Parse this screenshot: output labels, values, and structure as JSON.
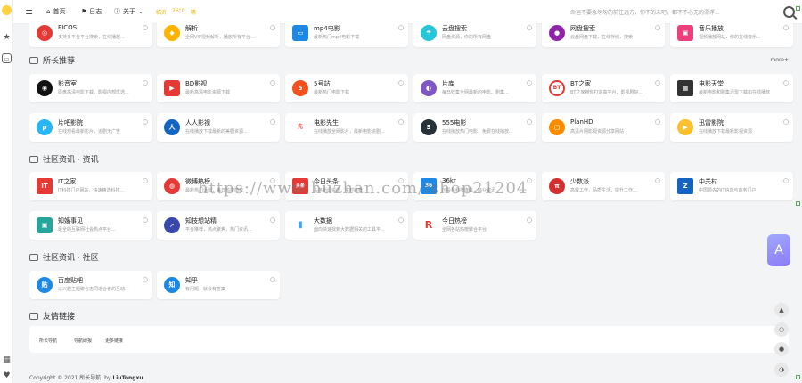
{
  "colors": {
    "accent": "#e5b200",
    "panel": "#ffffff",
    "bg": "#f3f4f6"
  },
  "topbar": {
    "menu_icon": "hamburger-icon",
    "nav": [
      {
        "label": "首页",
        "icon": "home-icon"
      },
      {
        "label": "日志",
        "icon": "flag-icon"
      },
      {
        "label": "关于",
        "icon": "info-icon"
      }
    ],
    "weather": {
      "city": "临沂",
      "temp": "26°C",
      "cond": "晴"
    },
    "slogan": "命运不要急匆匆的前往远方，你不的未吧，都不不心无的漂浮..."
  },
  "sections": [
    {
      "title": "所长推荐",
      "more": "more+"
    },
    {
      "title": "社区资讯 · 资讯"
    },
    {
      "title": "社区资讯 · 社区"
    },
    {
      "title": "友情链接"
    }
  ],
  "top_row": [
    {
      "name": "PICOS",
      "desc": "支持多平台平台搜索，在线播放..."
    },
    {
      "name": "解析",
      "desc": "全网VIP视频解析，播放所有平台..."
    },
    {
      "name": "mp4电影",
      "desc": "最新热门mp4电影下载"
    },
    {
      "name": "云盘搜索",
      "desc": "网盘资源，你的所有网盘"
    },
    {
      "name": "网盘搜索",
      "desc": "云盘网盘下载，在线存储，搜索"
    },
    {
      "name": "音乐播放",
      "desc": "视频播放网站，你的在线音乐..."
    }
  ],
  "recommend": [
    {
      "name": "影音室",
      "desc": "原盘高清电影下载，影视内部优选..."
    },
    {
      "name": "BD影视",
      "desc": "最新高清电影资源下载"
    },
    {
      "name": "5号站",
      "desc": "最新热门电影下载"
    },
    {
      "name": "片库",
      "desc": "每日收集全网最新的电影、剧集..."
    },
    {
      "name": "BT之家",
      "desc": "BT之家带你打造高平台，影视剧好..."
    },
    {
      "name": "电影天堂",
      "desc": "最新电影和剧集迅雷下载和在线播放"
    },
    {
      "name": "片吧影院",
      "desc": "在线观看最新影片，追剧无广告"
    },
    {
      "name": "人人影视",
      "desc": "在线播放下载最新的美剧资源..."
    },
    {
      "name": "电影先生",
      "desc": "在线播放全网影片，最新电影追剧..."
    },
    {
      "name": "555电影",
      "desc": "在线播放热门电影，免费在线播放..."
    },
    {
      "name": "PlanHD",
      "desc": "高清片网影视资源分享网站"
    },
    {
      "name": "迅雷影院",
      "desc": "在线播放下载最新影视资源"
    }
  ],
  "news": [
    {
      "name": "IT之家",
      "desc": "IT科技门户网站，快速精选科技..."
    },
    {
      "name": "微博热榜",
      "desc": "最新热门话题，每日热搜榜单"
    },
    {
      "name": "今日头条",
      "desc": "头条新闻资讯，实时推荐"
    },
    {
      "name": "36kr",
      "desc": "创投与科技媒体，商业资讯"
    },
    {
      "name": "少数派",
      "desc": "高效工作，品质生活，提升工作..."
    },
    {
      "name": "中关村",
      "desc": "中国领先的IT信息与商务门户"
    },
    {
      "name": "知嫂事见",
      "desc": "最全的互联网社会热点平台..."
    },
    {
      "name": "知技想站精",
      "desc": "平台推荐，热点聚焦，热门资讯..."
    },
    {
      "name": "大数据",
      "desc": "面向快速找到大数据相关的工具平..."
    },
    {
      "name": "今日热榜",
      "desc": "全网各站热榜聚合平台"
    }
  ],
  "community": [
    {
      "name": "百度贴吧",
      "desc": "以兴趣主题聚合志同道合者的互动..."
    },
    {
      "name": "知乎",
      "desc": "有问题，就会有答案"
    }
  ],
  "friend_links": [
    "所长导航",
    "导航研报",
    "更多链接"
  ],
  "footer": {
    "text": "Copyright © 2021 所长导航",
    "by": "by",
    "author": "LiuTongxu"
  },
  "watermark": "https://www.huzhan.com/ishop21204"
}
